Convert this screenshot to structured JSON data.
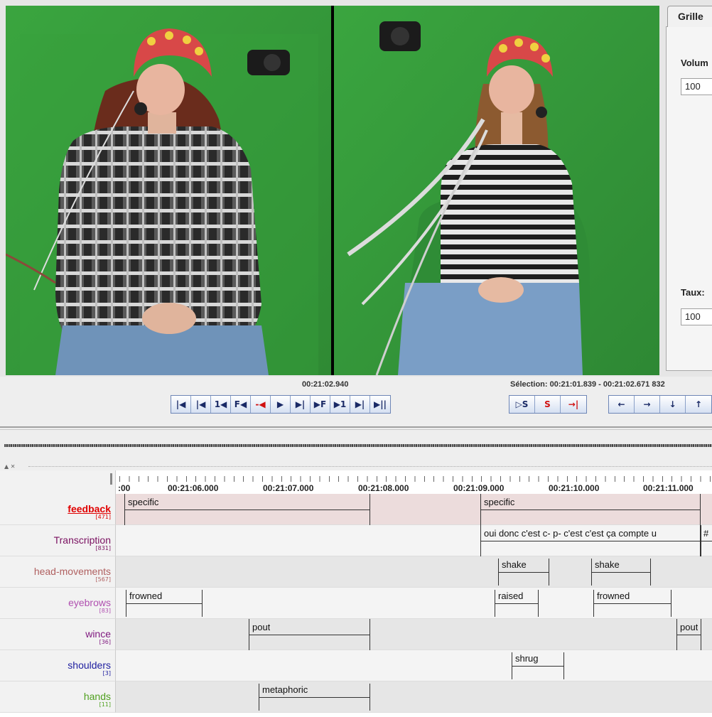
{
  "video": {
    "left_label": "video-left-participant",
    "right_label": "video-right-participant"
  },
  "side": {
    "tab": "Grille",
    "volume_label": "Volum",
    "volume_value": "100",
    "rate_label": "Taux:",
    "rate_value": "100"
  },
  "controls": {
    "current_time": "00:21:02.940",
    "selection": "Sélection: 00:21:01.839 - 00:21:02.671  832",
    "player_buttons": [
      "|◀",
      "|◀",
      "1◀",
      "F◀",
      "-◀",
      "▶",
      "▶|",
      "▶F",
      "▶1",
      "▶|",
      "▶||"
    ],
    "selection_buttons": [
      "▷S",
      "S",
      "→|"
    ],
    "nav_buttons": [
      "←",
      "→",
      "↓",
      "↑"
    ]
  },
  "ruler": {
    "labels": [
      ":00",
      "00:21:06.000",
      "00:21:07.000",
      "00:21:08.000",
      "00:21:09.000",
      "00:21:10.000",
      "00:21:11.000"
    ]
  },
  "tiers": [
    {
      "name": "feedback",
      "count": "[471]",
      "color": "#e00000",
      "bg": "#ecdcdc"
    },
    {
      "name": "Transcription",
      "count": "[831]",
      "color": "#7a1060",
      "bg": "#f4f4f4"
    },
    {
      "name": "head-movements",
      "count": "[567]",
      "color": "#b06060",
      "bg": "#e6e6e6"
    },
    {
      "name": "eyebrows",
      "count": "[83]",
      "color": "#b050b0",
      "bg": "#f4f4f4"
    },
    {
      "name": "wince",
      "count": "[36]",
      "color": "#801a80",
      "bg": "#e6e6e6"
    },
    {
      "name": "shoulders",
      "count": "[3]",
      "color": "#2020a0",
      "bg": "#f4f4f4"
    },
    {
      "name": "hands",
      "count": "[11]",
      "color": "#50a020",
      "bg": "#e6e6e6"
    }
  ],
  "annotations": {
    "feedback": [
      "specific",
      "specific"
    ],
    "transcription": [
      "oui donc c'est c- p- c'est c'est ça compte u",
      "#"
    ],
    "head": [
      "shake",
      "shake"
    ],
    "eyebrows": [
      "frowned",
      "raised",
      "frowned"
    ],
    "wince": [
      "pout",
      "pout"
    ],
    "shoulders": [
      "shrug"
    ],
    "hands": [
      "metaphoric"
    ]
  }
}
